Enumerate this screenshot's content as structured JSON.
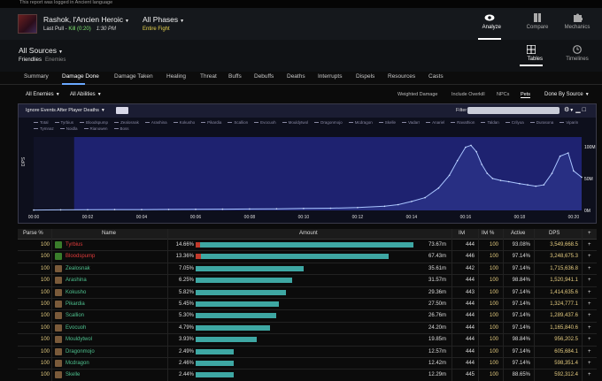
{
  "top_strip": "This report was logged in Ancient language",
  "header": {
    "boss_name": "Rashok, l'Ancien Heroic",
    "last_pull": "Last Pull - ",
    "kill": "Kill (0:20)",
    "time": "1:30 PM",
    "phase": "All Phases",
    "phase_sub": "Entire Fight",
    "nav": [
      {
        "label": "Analyze",
        "icon": "eye-icon",
        "active": true
      },
      {
        "label": "Compare",
        "icon": "compare-icon",
        "active": false
      },
      {
        "label": "Mechanics",
        "icon": "puzzle-icon",
        "active": false
      }
    ]
  },
  "sources": {
    "title": "All Sources",
    "friendlies": "Friendlies",
    "enemies": "Enemies",
    "views": [
      {
        "label": "Tables",
        "icon": "grid-icon",
        "active": true
      },
      {
        "label": "Timelines",
        "icon": "clock-icon",
        "active": false
      }
    ]
  },
  "tabs": [
    "Summary",
    "Damage Done",
    "Damage Taken",
    "Healing",
    "Threat",
    "Buffs",
    "Debuffs",
    "Deaths",
    "Interrupts",
    "Dispels",
    "Resources",
    "Casts"
  ],
  "active_tab": "Damage Done",
  "filters": {
    "enemies": "All Enemies",
    "abilities": "All Abilities",
    "options": [
      {
        "label": "Weighted Damage",
        "on": false
      },
      {
        "label": "Include Overkill",
        "on": false
      },
      {
        "label": "NPCs",
        "on": false
      },
      {
        "label": "Pets",
        "on": true
      }
    ],
    "group": "Done By Source"
  },
  "graph": {
    "ignore_label": "Ignore Events After Player Deaths",
    "filter_expression_label": "Filter Expression:",
    "y_axis_title": "DPS",
    "legend": [
      "Total",
      "Tyrbius",
      "Bloodspump",
      "Zealosnak",
      "Arashina",
      "Kokusho",
      "Pikardia",
      "Scallion",
      "Evocuoh",
      "Mouldytwol",
      "Dragonmojo",
      "Mcdragon",
      "Skelle",
      "Vadarr",
      "Anariel",
      "Ravathion",
      "Taldan",
      "Crilyoa",
      "Durasona",
      "Viparin",
      "Tymnaz",
      "Noidla",
      "Rianowen",
      "Boss"
    ],
    "chart_data": {
      "type": "area",
      "title": "",
      "xlabel": "",
      "ylabel": "DPS",
      "x_ticks": [
        "00:00",
        "00:02",
        "00:04",
        "00:06",
        "00:08",
        "00:10",
        "00:12",
        "00:14",
        "00:16",
        "00:18",
        "00:20"
      ],
      "y_ticks": [
        "100M",
        "50M",
        "0M"
      ],
      "ylim": [
        0,
        115000000
      ],
      "xlim": [
        0,
        20.3
      ],
      "shaded_range": [
        1.5,
        20.3
      ],
      "series": [
        {
          "name": "Total",
          "x": [
            0,
            1,
            2,
            3,
            4,
            5,
            6,
            7,
            8,
            9,
            10,
            11,
            12,
            13,
            13.5,
            14,
            14.5,
            15,
            15.4,
            15.7,
            16,
            16.2,
            16.4,
            16.6,
            16.8,
            17,
            17.3,
            17.6,
            18,
            18.3,
            18.6,
            18.9,
            19.2,
            19.5,
            19.8,
            20,
            20.3
          ],
          "y": [
            500000,
            800000,
            1000000,
            1200000,
            1300000,
            1500000,
            1800000,
            2000000,
            2200000,
            2500000,
            3000000,
            3500000,
            4500000,
            6500000,
            9000000,
            14000000,
            20000000,
            35000000,
            55000000,
            78000000,
            99000000,
            102000000,
            92000000,
            72000000,
            58000000,
            50000000,
            47000000,
            45000000,
            42000000,
            40000000,
            38000000,
            40000000,
            58000000,
            85000000,
            90000000,
            62000000,
            52000000
          ]
        }
      ]
    }
  },
  "table": {
    "headers": [
      "Parse %",
      "Name",
      "Amount",
      "Ilvl",
      "Ilvl %",
      "Active",
      "DPS",
      "+"
    ],
    "rows": [
      {
        "parse": "100",
        "name": "Tyrbius",
        "name_color": "#e03b3b",
        "icon_color": "#3a7d2b",
        "pct": "14.66%",
        "red": 0.02,
        "teal": 0.97,
        "amount": "73.67m",
        "ilvl": "444",
        "ilvlp": "100",
        "active": "93.08%",
        "dps": "3,549,668.5"
      },
      {
        "parse": "100",
        "name": "Bloodspump",
        "name_color": "#e03b3b",
        "icon_color": "#3a7d2b",
        "pct": "13.36%",
        "red": 0.025,
        "teal": 0.86,
        "amount": "67.43m",
        "ilvl": "446",
        "ilvlp": "100",
        "active": "97.14%",
        "dps": "3,248,675.3"
      },
      {
        "parse": "100",
        "name": "Zealosnak",
        "name_color": "#4ec08e",
        "icon_color": "#7a5a3a",
        "pct": "7.05%",
        "red": 0,
        "teal": 0.48,
        "amount": "35.61m",
        "ilvl": "442",
        "ilvlp": "100",
        "active": "97.14%",
        "dps": "1,715,636.8"
      },
      {
        "parse": "100",
        "name": "Arashina",
        "name_color": "#4ec08e",
        "icon_color": "#7a5a3a",
        "pct": "6.25%",
        "red": 0,
        "teal": 0.43,
        "amount": "31.57m",
        "ilvl": "444",
        "ilvlp": "100",
        "active": "98.84%",
        "dps": "1,520,941.1"
      },
      {
        "parse": "100",
        "name": "Kokusho",
        "name_color": "#4ec08e",
        "icon_color": "#7a5a3a",
        "pct": "5.82%",
        "red": 0,
        "teal": 0.4,
        "amount": "29.36m",
        "ilvl": "443",
        "ilvlp": "100",
        "active": "97.14%",
        "dps": "1,414,635.6"
      },
      {
        "parse": "100",
        "name": "Pikardia",
        "name_color": "#4ec08e",
        "icon_color": "#7a5a3a",
        "pct": "5.45%",
        "red": 0,
        "teal": 0.37,
        "amount": "27.50m",
        "ilvl": "444",
        "ilvlp": "100",
        "active": "97.14%",
        "dps": "1,324,777.1"
      },
      {
        "parse": "100",
        "name": "Scallion",
        "name_color": "#4ec08e",
        "icon_color": "#7a5a3a",
        "pct": "5.30%",
        "red": 0,
        "teal": 0.36,
        "amount": "26.76m",
        "ilvl": "444",
        "ilvlp": "100",
        "active": "97.14%",
        "dps": "1,289,437.6"
      },
      {
        "parse": "100",
        "name": "Evocuoh",
        "name_color": "#4ec08e",
        "icon_color": "#7a5a3a",
        "pct": "4.79%",
        "red": 0,
        "teal": 0.33,
        "amount": "24.20m",
        "ilvl": "444",
        "ilvlp": "100",
        "active": "97.14%",
        "dps": "1,165,840.6"
      },
      {
        "parse": "100",
        "name": "Mouldytwol",
        "name_color": "#4ec08e",
        "icon_color": "#7a5a3a",
        "pct": "3.93%",
        "red": 0,
        "teal": 0.27,
        "amount": "19.85m",
        "ilvl": "444",
        "ilvlp": "100",
        "active": "98.84%",
        "dps": "956,202.5"
      },
      {
        "parse": "100",
        "name": "Dragonmojo",
        "name_color": "#4ec08e",
        "icon_color": "#7a5a3a",
        "pct": "2.49%",
        "red": 0,
        "teal": 0.17,
        "amount": "12.57m",
        "ilvl": "444",
        "ilvlp": "100",
        "active": "97.14%",
        "dps": "605,684.1"
      },
      {
        "parse": "100",
        "name": "Mcdragon",
        "name_color": "#4ec08e",
        "icon_color": "#7a5a3a",
        "pct": "2.46%",
        "red": 0,
        "teal": 0.17,
        "amount": "12.42m",
        "ilvl": "444",
        "ilvlp": "100",
        "active": "97.14%",
        "dps": "598,351.4"
      },
      {
        "parse": "100",
        "name": "Skelle",
        "name_color": "#4ec08e",
        "icon_color": "#7a5a3a",
        "pct": "2.44%",
        "red": 0,
        "teal": 0.17,
        "amount": "12.29m",
        "ilvl": "445",
        "ilvlp": "100",
        "active": "88.65%",
        "dps": "592,312.4"
      }
    ]
  }
}
